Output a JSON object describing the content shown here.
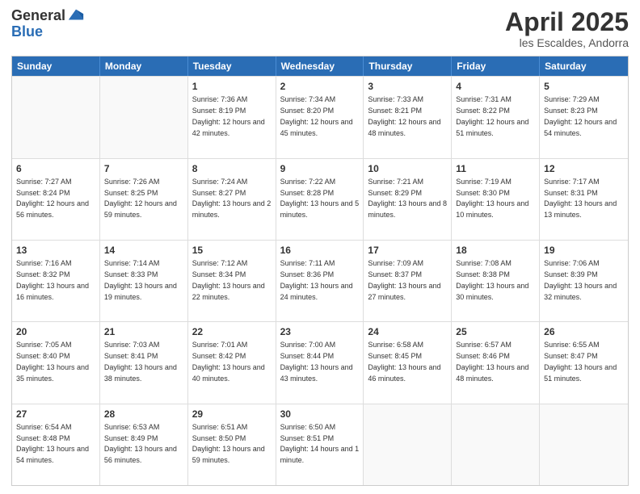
{
  "logo": {
    "general": "General",
    "blue": "Blue"
  },
  "title": "April 2025",
  "subtitle": "les Escaldes, Andorra",
  "days": [
    "Sunday",
    "Monday",
    "Tuesday",
    "Wednesday",
    "Thursday",
    "Friday",
    "Saturday"
  ],
  "weeks": [
    [
      {
        "day": "",
        "sunrise": "",
        "sunset": "",
        "daylight": ""
      },
      {
        "day": "",
        "sunrise": "",
        "sunset": "",
        "daylight": ""
      },
      {
        "day": "1",
        "sunrise": "Sunrise: 7:36 AM",
        "sunset": "Sunset: 8:19 PM",
        "daylight": "Daylight: 12 hours and 42 minutes."
      },
      {
        "day": "2",
        "sunrise": "Sunrise: 7:34 AM",
        "sunset": "Sunset: 8:20 PM",
        "daylight": "Daylight: 12 hours and 45 minutes."
      },
      {
        "day": "3",
        "sunrise": "Sunrise: 7:33 AM",
        "sunset": "Sunset: 8:21 PM",
        "daylight": "Daylight: 12 hours and 48 minutes."
      },
      {
        "day": "4",
        "sunrise": "Sunrise: 7:31 AM",
        "sunset": "Sunset: 8:22 PM",
        "daylight": "Daylight: 12 hours and 51 minutes."
      },
      {
        "day": "5",
        "sunrise": "Sunrise: 7:29 AM",
        "sunset": "Sunset: 8:23 PM",
        "daylight": "Daylight: 12 hours and 54 minutes."
      }
    ],
    [
      {
        "day": "6",
        "sunrise": "Sunrise: 7:27 AM",
        "sunset": "Sunset: 8:24 PM",
        "daylight": "Daylight: 12 hours and 56 minutes."
      },
      {
        "day": "7",
        "sunrise": "Sunrise: 7:26 AM",
        "sunset": "Sunset: 8:25 PM",
        "daylight": "Daylight: 12 hours and 59 minutes."
      },
      {
        "day": "8",
        "sunrise": "Sunrise: 7:24 AM",
        "sunset": "Sunset: 8:27 PM",
        "daylight": "Daylight: 13 hours and 2 minutes."
      },
      {
        "day": "9",
        "sunrise": "Sunrise: 7:22 AM",
        "sunset": "Sunset: 8:28 PM",
        "daylight": "Daylight: 13 hours and 5 minutes."
      },
      {
        "day": "10",
        "sunrise": "Sunrise: 7:21 AM",
        "sunset": "Sunset: 8:29 PM",
        "daylight": "Daylight: 13 hours and 8 minutes."
      },
      {
        "day": "11",
        "sunrise": "Sunrise: 7:19 AM",
        "sunset": "Sunset: 8:30 PM",
        "daylight": "Daylight: 13 hours and 10 minutes."
      },
      {
        "day": "12",
        "sunrise": "Sunrise: 7:17 AM",
        "sunset": "Sunset: 8:31 PM",
        "daylight": "Daylight: 13 hours and 13 minutes."
      }
    ],
    [
      {
        "day": "13",
        "sunrise": "Sunrise: 7:16 AM",
        "sunset": "Sunset: 8:32 PM",
        "daylight": "Daylight: 13 hours and 16 minutes."
      },
      {
        "day": "14",
        "sunrise": "Sunrise: 7:14 AM",
        "sunset": "Sunset: 8:33 PM",
        "daylight": "Daylight: 13 hours and 19 minutes."
      },
      {
        "day": "15",
        "sunrise": "Sunrise: 7:12 AM",
        "sunset": "Sunset: 8:34 PM",
        "daylight": "Daylight: 13 hours and 22 minutes."
      },
      {
        "day": "16",
        "sunrise": "Sunrise: 7:11 AM",
        "sunset": "Sunset: 8:36 PM",
        "daylight": "Daylight: 13 hours and 24 minutes."
      },
      {
        "day": "17",
        "sunrise": "Sunrise: 7:09 AM",
        "sunset": "Sunset: 8:37 PM",
        "daylight": "Daylight: 13 hours and 27 minutes."
      },
      {
        "day": "18",
        "sunrise": "Sunrise: 7:08 AM",
        "sunset": "Sunset: 8:38 PM",
        "daylight": "Daylight: 13 hours and 30 minutes."
      },
      {
        "day": "19",
        "sunrise": "Sunrise: 7:06 AM",
        "sunset": "Sunset: 8:39 PM",
        "daylight": "Daylight: 13 hours and 32 minutes."
      }
    ],
    [
      {
        "day": "20",
        "sunrise": "Sunrise: 7:05 AM",
        "sunset": "Sunset: 8:40 PM",
        "daylight": "Daylight: 13 hours and 35 minutes."
      },
      {
        "day": "21",
        "sunrise": "Sunrise: 7:03 AM",
        "sunset": "Sunset: 8:41 PM",
        "daylight": "Daylight: 13 hours and 38 minutes."
      },
      {
        "day": "22",
        "sunrise": "Sunrise: 7:01 AM",
        "sunset": "Sunset: 8:42 PM",
        "daylight": "Daylight: 13 hours and 40 minutes."
      },
      {
        "day": "23",
        "sunrise": "Sunrise: 7:00 AM",
        "sunset": "Sunset: 8:44 PM",
        "daylight": "Daylight: 13 hours and 43 minutes."
      },
      {
        "day": "24",
        "sunrise": "Sunrise: 6:58 AM",
        "sunset": "Sunset: 8:45 PM",
        "daylight": "Daylight: 13 hours and 46 minutes."
      },
      {
        "day": "25",
        "sunrise": "Sunrise: 6:57 AM",
        "sunset": "Sunset: 8:46 PM",
        "daylight": "Daylight: 13 hours and 48 minutes."
      },
      {
        "day": "26",
        "sunrise": "Sunrise: 6:55 AM",
        "sunset": "Sunset: 8:47 PM",
        "daylight": "Daylight: 13 hours and 51 minutes."
      }
    ],
    [
      {
        "day": "27",
        "sunrise": "Sunrise: 6:54 AM",
        "sunset": "Sunset: 8:48 PM",
        "daylight": "Daylight: 13 hours and 54 minutes."
      },
      {
        "day": "28",
        "sunrise": "Sunrise: 6:53 AM",
        "sunset": "Sunset: 8:49 PM",
        "daylight": "Daylight: 13 hours and 56 minutes."
      },
      {
        "day": "29",
        "sunrise": "Sunrise: 6:51 AM",
        "sunset": "Sunset: 8:50 PM",
        "daylight": "Daylight: 13 hours and 59 minutes."
      },
      {
        "day": "30",
        "sunrise": "Sunrise: 6:50 AM",
        "sunset": "Sunset: 8:51 PM",
        "daylight": "Daylight: 14 hours and 1 minute."
      },
      {
        "day": "",
        "sunrise": "",
        "sunset": "",
        "daylight": ""
      },
      {
        "day": "",
        "sunrise": "",
        "sunset": "",
        "daylight": ""
      },
      {
        "day": "",
        "sunrise": "",
        "sunset": "",
        "daylight": ""
      }
    ]
  ]
}
